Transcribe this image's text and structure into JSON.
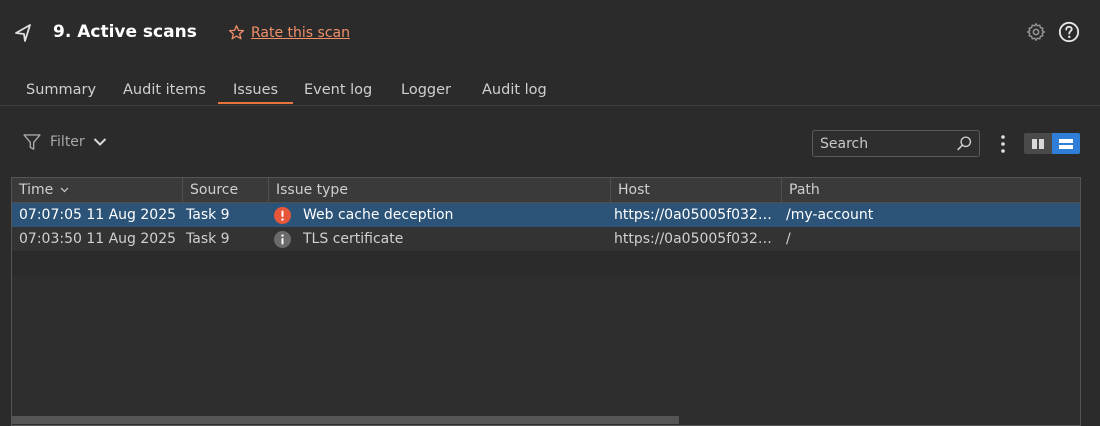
{
  "header": {
    "title": "9. Active scans",
    "rate_label": "Rate this scan",
    "accent_color": "#f0916a"
  },
  "tabs": [
    {
      "label": "Summary",
      "active": false
    },
    {
      "label": "Audit items",
      "active": false
    },
    {
      "label": "Issues",
      "active": true
    },
    {
      "label": "Event log",
      "active": false
    },
    {
      "label": "Logger",
      "active": false
    },
    {
      "label": "Audit log",
      "active": false
    }
  ],
  "toolbar": {
    "filter_label": "Filter",
    "search_placeholder": "Search"
  },
  "table": {
    "columns": [
      "Time",
      "Source",
      "Issue type",
      "Host",
      "Path"
    ],
    "sort_indicator": "Time",
    "rows": [
      {
        "time": "07:07:05 11 Aug 2025",
        "source": "Task 9",
        "severity": "high",
        "severity_icon": "exclamation-icon",
        "issue_type": "Web cache deception",
        "host": "https://0a05005f0327...",
        "path": "/my-account",
        "selected": true
      },
      {
        "time": "07:03:50 11 Aug 2025",
        "source": "Task 9",
        "severity": "info",
        "severity_icon": "info-icon",
        "issue_type": "TLS certificate",
        "host": "https://0a05005f0327...",
        "path": "/",
        "selected": false
      }
    ]
  },
  "colors": {
    "selected_row": "#2c5478",
    "active_tab_underline": "#e8743b",
    "view_toggle_active": "#2f7ed8",
    "severity_high": "#e8563a",
    "severity_info": "#6b6b6b"
  }
}
